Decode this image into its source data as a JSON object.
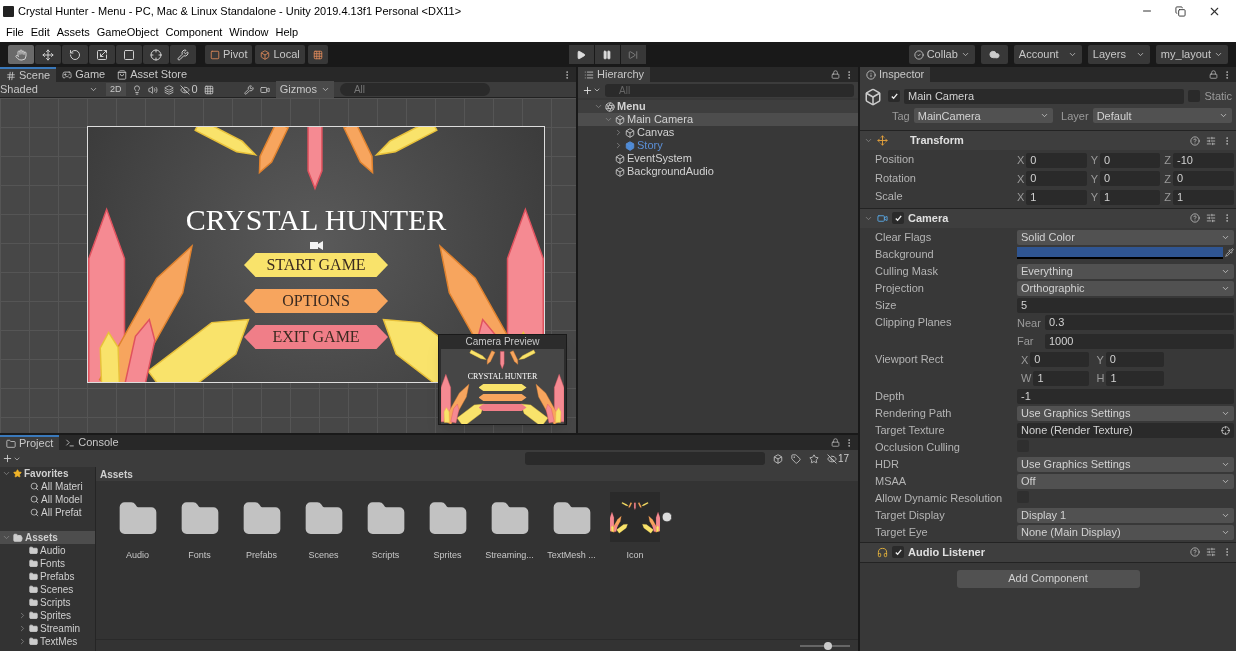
{
  "window": {
    "title": "Crystal Hunter - Menu - PC, Mac & Linux Standalone - Unity 2019.4.13f1 Personal <DX11>"
  },
  "menu": [
    "File",
    "Edit",
    "Assets",
    "GameObject",
    "Component",
    "Window",
    "Help"
  ],
  "toolbar": {
    "tools": [
      {
        "selected": true
      },
      {
        "selected": false
      },
      {
        "selected": false
      },
      {
        "selected": false
      },
      {
        "selected": false
      },
      {
        "selected": false
      },
      {
        "selected": false
      }
    ],
    "pivot": "Pivot",
    "local": "Local",
    "collab": "Collab",
    "account": "Account",
    "layers": "Layers",
    "layout": "my_layout"
  },
  "scene": {
    "tabs": [
      {
        "label": "Scene",
        "kind": "scene",
        "selected": true
      },
      {
        "label": "Game",
        "kind": "game",
        "selected": false
      },
      {
        "label": "Asset Store",
        "kind": "store",
        "selected": false
      }
    ],
    "shading": "Shaded",
    "mode_2d": "2D",
    "hidden_count": "0",
    "gizmos": "Gizmos",
    "search_placeholder": "All",
    "game_title": "CRYSTAL HUNTER",
    "menu_buttons": [
      {
        "label": "START GAME",
        "color": "#f9e36b"
      },
      {
        "label": "OPTIONS",
        "color": "#f7a55e"
      },
      {
        "label": "EXIT GAME",
        "color": "#f07e88"
      }
    ],
    "camera_preview": {
      "title": "Camera Preview",
      "game_title": "CRYSTAL HUNTER"
    }
  },
  "hierarchy": {
    "title": "Hierarchy",
    "search_placeholder": "All",
    "tree": [
      {
        "label": "Menu",
        "kind": "scene",
        "expanded": true,
        "selected": false,
        "children": [
          {
            "label": "Main Camera",
            "kind": "gameobject",
            "expanded": true,
            "selected": true,
            "children": [
              {
                "label": "Canvas",
                "kind": "gameobject",
                "expanded": false,
                "selected": false
              },
              {
                "label": "Story",
                "kind": "prefab",
                "expanded": false,
                "selected": false
              }
            ]
          },
          {
            "label": "EventSystem",
            "kind": "gameobject",
            "selected": false
          },
          {
            "label": "BackgroundAudio",
            "kind": "gameobject",
            "selected": false
          }
        ]
      }
    ]
  },
  "inspector": {
    "title": "Inspector",
    "object": {
      "active": true,
      "name": "Main Camera",
      "static_label": "Static",
      "static": false,
      "tag_label": "Tag",
      "tag": "MainCamera",
      "layer_label": "Layer",
      "layer": "Default"
    },
    "components": [
      {
        "name": "Transform",
        "kind": "transform",
        "expanded": true,
        "rows": [
          {
            "label": "Position",
            "kind": "vector",
            "fields": [
              {
                "axis": "X",
                "value": "0"
              },
              {
                "axis": "Y",
                "value": "0"
              },
              {
                "axis": "Z",
                "value": "-10"
              }
            ]
          },
          {
            "label": "Rotation",
            "kind": "vector",
            "fields": [
              {
                "axis": "X",
                "value": "0"
              },
              {
                "axis": "Y",
                "value": "0"
              },
              {
                "axis": "Z",
                "value": "0"
              }
            ]
          },
          {
            "label": "Scale",
            "kind": "vector",
            "fields": [
              {
                "axis": "X",
                "value": "1"
              },
              {
                "axis": "Y",
                "value": "1"
              },
              {
                "axis": "Z",
                "value": "1"
              }
            ]
          }
        ]
      },
      {
        "name": "Camera",
        "kind": "camera",
        "enabled": true,
        "expanded": true,
        "rows": [
          {
            "label": "Clear Flags",
            "kind": "dropdown",
            "value": "Solid Color"
          },
          {
            "label": "Background",
            "kind": "color",
            "color": "#2f5592"
          },
          {
            "label": "Culling Mask",
            "kind": "dropdown",
            "value": "Everything"
          },
          {
            "label": "Projection",
            "kind": "dropdown",
            "value": "Orthographic"
          },
          {
            "label": "Size",
            "kind": "field",
            "value": "5"
          },
          {
            "label": "Clipping Planes",
            "kind": "labeled_fields",
            "fields": [
              {
                "label": "Near",
                "value": "0.3"
              },
              {
                "label": "Far",
                "value": "1000"
              }
            ]
          },
          {
            "label": "Viewport Rect",
            "kind": "rect",
            "fields": [
              {
                "axis": "X",
                "value": "0"
              },
              {
                "axis": "Y",
                "value": "0"
              },
              {
                "axis": "W",
                "value": "1"
              },
              {
                "axis": "H",
                "value": "1"
              }
            ]
          },
          {
            "label": "Depth",
            "kind": "field",
            "value": "-1"
          },
          {
            "label": "Rendering Path",
            "kind": "dropdown",
            "value": "Use Graphics Settings"
          },
          {
            "label": "Target Texture",
            "kind": "object",
            "value": "None (Render Texture)"
          },
          {
            "label": "Occlusion Culling",
            "kind": "checkbox",
            "checked": false
          },
          {
            "label": "HDR",
            "kind": "dropdown",
            "value": "Use Graphics Settings"
          },
          {
            "label": "MSAA",
            "kind": "dropdown",
            "value": "Off"
          },
          {
            "label": "Allow Dynamic Resolution",
            "kind": "checkbox",
            "checked": false
          },
          {
            "label": "Target Display",
            "kind": "dropdown",
            "value": "Display 1"
          },
          {
            "label": "Target Eye",
            "kind": "dropdown",
            "value": "None (Main Display)"
          }
        ]
      },
      {
        "name": "Audio Listener",
        "kind": "audio_listener",
        "enabled": true
      }
    ],
    "add_component": "Add Component"
  },
  "project": {
    "tabs": [
      {
        "label": "Project",
        "kind": "project",
        "selected": true
      },
      {
        "label": "Console",
        "kind": "console",
        "selected": false
      }
    ],
    "hidden_count": "17",
    "favorites": {
      "label": "Favorites",
      "expanded": true,
      "children": [
        {
          "label": "All Materi"
        },
        {
          "label": "All Model"
        },
        {
          "label": "All Prefat"
        }
      ]
    },
    "assets_tree": {
      "label": "Assets",
      "expanded": true,
      "selected": true,
      "children": [
        {
          "label": "Audio"
        },
        {
          "label": "Fonts"
        },
        {
          "label": "Prefabs"
        },
        {
          "label": "Scenes"
        },
        {
          "label": "Scripts"
        },
        {
          "label": "Sprites",
          "expanded": false
        },
        {
          "label": "Streamin",
          "expanded": false
        },
        {
          "label": "TextMes",
          "expanded": false
        }
      ]
    },
    "breadcrumb": "Assets",
    "items": [
      {
        "label": "Audio",
        "kind": "folder"
      },
      {
        "label": "Fonts",
        "kind": "folder"
      },
      {
        "label": "Prefabs",
        "kind": "folder"
      },
      {
        "label": "Scenes",
        "kind": "folder"
      },
      {
        "label": "Scripts",
        "kind": "folder"
      },
      {
        "label": "Sprites",
        "kind": "folder"
      },
      {
        "label": "Streaming...",
        "kind": "folder"
      },
      {
        "label": "TextMesh ...",
        "kind": "folder"
      },
      {
        "label": "Icon",
        "kind": "sprite"
      }
    ],
    "icon_size": {
      "level": 0.55
    }
  }
}
